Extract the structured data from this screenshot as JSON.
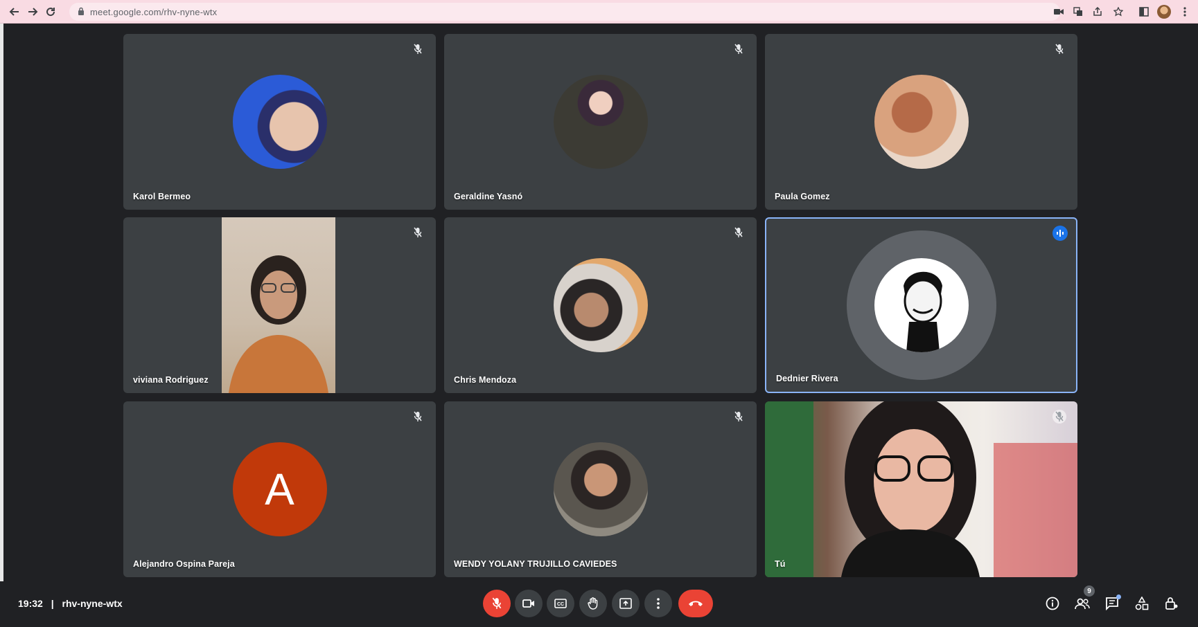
{
  "browser": {
    "url": "meet.google.com/rhv-nyne-wtx"
  },
  "tiles": [
    {
      "name": "Karol Bermeo"
    },
    {
      "name": "Geraldine Yasnó"
    },
    {
      "name": "Paula Gomez"
    },
    {
      "name": "viviana Rodriguez"
    },
    {
      "name": "Chris Mendoza"
    },
    {
      "name": "Dednier Rivera"
    },
    {
      "name": "Alejandro Ospina Pareja",
      "initial": "A"
    },
    {
      "name": "WENDY YOLANY TRUJILLO CAVIEDES"
    },
    {
      "name": "Tú"
    }
  ],
  "footer": {
    "time": "19:32",
    "separator": "|",
    "meeting_code": "rhv-nyne-wtx",
    "participant_count": "9"
  },
  "colors": {
    "tile_bg": "#3c4043",
    "active_border": "#8ab4f8",
    "danger": "#ea4335",
    "avatar_letter_bg": "#c1390a"
  }
}
